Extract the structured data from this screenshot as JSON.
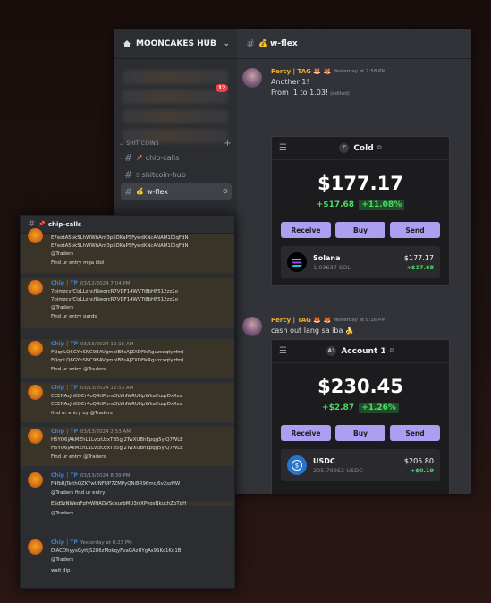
{
  "server": {
    "name": "MOONCAKES HUB",
    "badge": "12"
  },
  "sidebar": {
    "category": "SHIT COINS",
    "channels": [
      {
        "label": "chip-calls",
        "prefix": "📌"
      },
      {
        "label": "shitcoin-hub",
        "prefix": "▯"
      },
      {
        "label": "w-flex",
        "prefix": "💰"
      }
    ]
  },
  "chat": {
    "channel": "w-flex",
    "messages": [
      {
        "author": "Percy | TAG 🦊 🦊",
        "time": "Yesterday at 7:58 PM",
        "lines": [
          "Another 1!",
          "From .1 to 1.03!"
        ],
        "edited": "(edited)"
      },
      {
        "author": "Percy | TAG 🦊 🦊",
        "time": "Yesterday at 8:16 PM",
        "lines": [
          "cash out lang sa iba 🍌"
        ]
      }
    ]
  },
  "wallets": [
    {
      "account": "Cold",
      "badge": "C",
      "balance": "$177.17",
      "change_abs": "+$17.68",
      "change_pct": "+11.08%",
      "buttons": [
        "Receive",
        "Buy",
        "Send"
      ],
      "token": {
        "name": "Solana",
        "amount": "1.03637 SOL",
        "value": "$177.17",
        "change": "+$17.68"
      }
    },
    {
      "account": "Account 1",
      "badge": "A1",
      "balance": "$230.45",
      "change_abs": "+$2.87",
      "change_pct": "+1.26%",
      "buttons": [
        "Receive",
        "Buy",
        "Send"
      ],
      "token": {
        "name": "USDC",
        "amount": "205.79952 USDC",
        "value": "$205.80",
        "change": "+$0.19"
      }
    }
  ],
  "chip_calls": {
    "channel": "chip-calls",
    "messages": [
      {
        "author": "",
        "time": "",
        "lines": [
          "E7eotA5pk5LhWWhAnt3p5DKaPSFywdKNcANAM1DiqFdN",
          "E7eotA5pk5LhWWhAnt3p5DKaPSFywdKNcANAM1DiqFdN",
          "@Traders",
          "Find ur entry mga idol"
        ]
      },
      {
        "author": "Chip | TP",
        "time": "03/12/2024 7:04 PM",
        "lines": [
          "7pjmzcvfCJzLLzhcfNworcR7VDF14WVTi8bHF512zz2o",
          "7pjmzcvfCJzLLzhcfNworcR7VDF14WVTi8bHF512zz2o",
          "@Traders",
          "Find ur entry pards"
        ]
      },
      {
        "author": "Chip | TP",
        "time": "03/13/2024 12:16 AM",
        "lines": [
          "FQqnLQ6GYnSNC9BAVgmpIBFsAJZXDFikRguzcxqtyzfmJ",
          "FQqnLQ6GYnSNC9BAVgmpIBFsAJZXDFikRguzcxqtyzfmJ",
          "Find ur entry @Traders"
        ]
      },
      {
        "author": "Chip | TP",
        "time": "03/13/2024 12:53 AM",
        "lines": [
          "CEENAzJnKQCr4oQ4tIPonv5LVhNrRUHpWkaCuqrDsRxs",
          "CEENAzJnKQCr4oQ4tIPonv5LVhNrRUHpWkaCuqrDsRxs",
          "find ur entry uy @Traders"
        ]
      },
      {
        "author": "Chip | TP",
        "time": "03/13/2024 2:53 AM",
        "lines": [
          "H6YQ6jAkMZhL1LvtzUzxTB5gJ2TwXUBhEpqg5yiQ7WLE",
          "H6YQ6jAkMZhL1LvtzUzxTB5gJ2TwXUBhEpqg5yiQ7WLE",
          "Find ur entry @Traders"
        ]
      },
      {
        "author": "Chip | TP",
        "time": "03/13/2024 8:39 PM",
        "lines": [
          "F4fbRjTeithQZKYwUNFUP7ZMPyQNiBR96mcJ6v2szNW",
          "@Traders find ur entry",
          "ESdSzNWegFpfvWHADVSdxurbMU3rrXPvgsNkuchZbTpH",
          "@Traders"
        ]
      },
      {
        "author": "Chip | TP",
        "time": "Yesterday at 8:23 PM",
        "lines": [
          "DiACDhyysGyttJS286zMokqyFvaGAzUYgAs9SKc1Kd1B",
          "@Traders",
          "wait dip"
        ]
      }
    ]
  }
}
